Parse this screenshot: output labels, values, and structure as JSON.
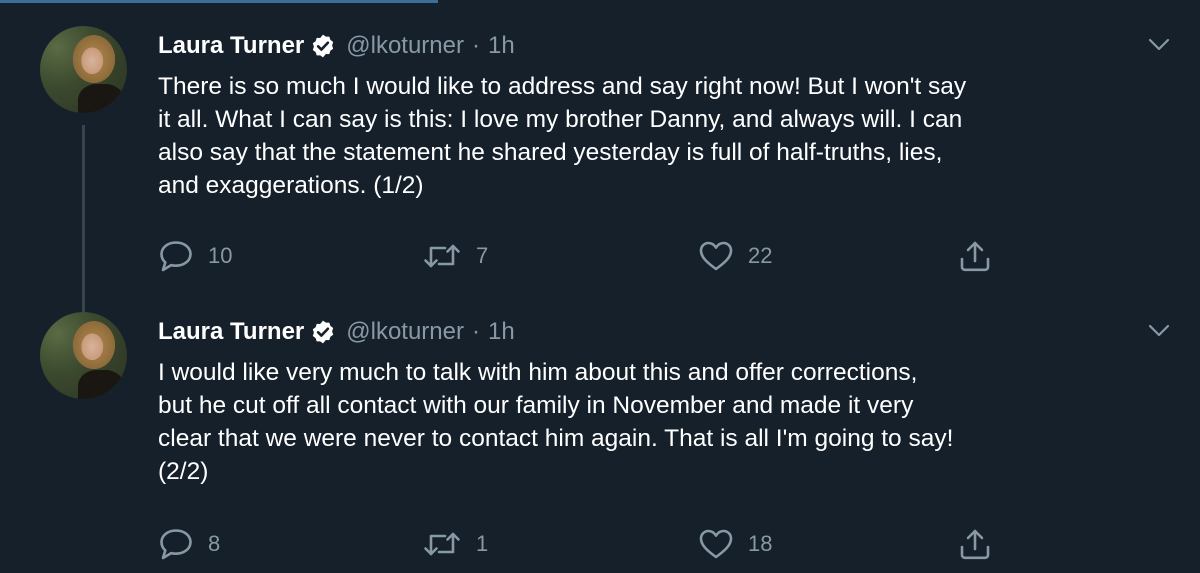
{
  "tweets": [
    {
      "name": "Laura Turner",
      "handle": "@lkoturner",
      "separator": "·",
      "time": "1h",
      "text": "There is so much I would like to address and say right now! But I won't say\nit all. What I can say is this: I love my brother Danny, and always will. I can\nalso say that the statement he shared yesterday is full of half-truths, lies,\nand exaggerations. (1/2)",
      "replies": "10",
      "retweets": "7",
      "likes": "22"
    },
    {
      "name": "Laura Turner",
      "handle": "@lkoturner",
      "separator": "·",
      "time": "1h",
      "text": "I would like very much to talk with him about this and offer corrections,\nbut he cut off all contact with our family in November and made it very\nclear that we were never to contact him again. That is all I'm going to say!\n(2/2)",
      "replies": "8",
      "retweets": "1",
      "likes": "18"
    }
  ],
  "icons": {
    "reply": "speech-bubble-icon",
    "retweet": "retweet-arrows-icon",
    "like": "heart-outline-icon",
    "share": "share-upload-icon",
    "verified": "verified-badge-icon",
    "more": "chevron-down-icon"
  },
  "colors": {
    "background": "#15202b",
    "text": "#ffffff",
    "secondary": "#8899a6",
    "thread_line": "#38444d"
  }
}
